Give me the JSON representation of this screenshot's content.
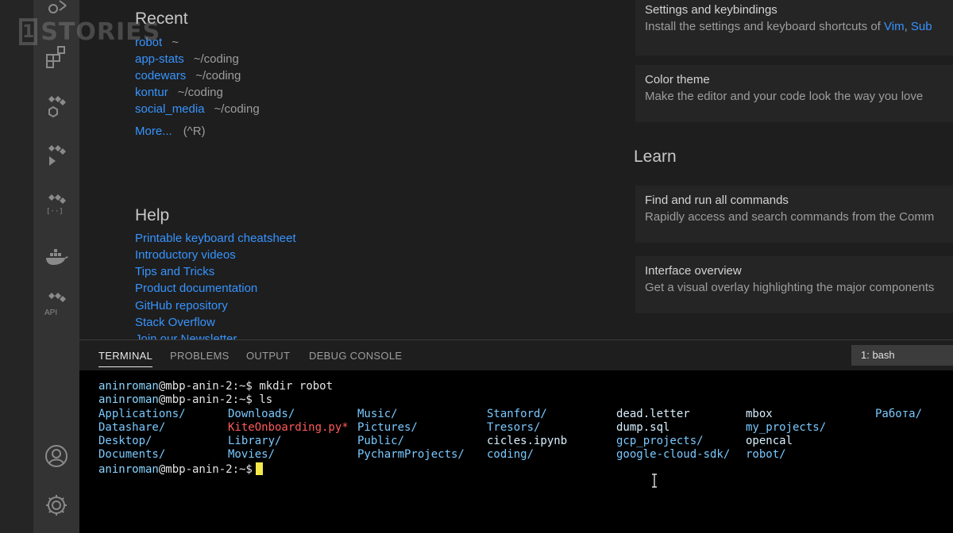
{
  "watermark": {
    "box": "1",
    "text": "STORIES"
  },
  "recent": {
    "title": "Recent",
    "items": [
      {
        "name": "robot",
        "path": "~"
      },
      {
        "name": "app-stats",
        "path": "~/coding"
      },
      {
        "name": "codewars",
        "path": "~/coding"
      },
      {
        "name": "kontur",
        "path": "~/coding"
      },
      {
        "name": "social_media",
        "path": "~/coding"
      }
    ],
    "more": "More...",
    "more_shortcut": "(^R)"
  },
  "help": {
    "title": "Help",
    "items": [
      "Printable keyboard cheatsheet",
      "Introductory videos",
      "Tips and Tricks",
      "Product documentation",
      "GitHub repository",
      "Stack Overflow",
      "Join our Newsletter"
    ]
  },
  "customize_cards": [
    {
      "title": "Settings and keybindings",
      "desc": "Install the settings and keyboard shortcuts of ",
      "links": [
        "Vim",
        "Sub"
      ]
    },
    {
      "title": "Color theme",
      "desc": "Make the editor and your code look the way you love"
    }
  ],
  "learn": {
    "title": "Learn",
    "cards": [
      {
        "title": "Find and run all commands",
        "desc": "Rapidly access and search commands from the Comm"
      },
      {
        "title": "Interface overview",
        "desc": "Get a visual overlay highlighting the major components"
      }
    ]
  },
  "activity": {
    "api_label": "API"
  },
  "panel": {
    "tabs": [
      "TERMINAL",
      "PROBLEMS",
      "OUTPUT",
      "DEBUG CONSOLE"
    ],
    "active_tab": "TERMINAL",
    "shell": "1: bash"
  },
  "terminal": {
    "prompt_user": "aninroman",
    "prompt_host": "@mbp-anin-2:~$",
    "commands": [
      "mkdir robot",
      "ls"
    ],
    "ls_rows": [
      [
        "Applications/",
        "Downloads/",
        "Music/",
        "Stanford/",
        "dead.letter",
        "mbox",
        "Работа/"
      ],
      [
        "Datashare/",
        "KiteOnboarding.py*",
        "Pictures/",
        "Tresors/",
        "dump.sql",
        "my_projects/",
        ""
      ],
      [
        "Desktop/",
        "Library/",
        "Public/",
        "cicles.ipynb",
        "gcp_projects/",
        "opencal",
        ""
      ],
      [
        "Documents/",
        "Movies/",
        "PycharmProjects/",
        "coding/",
        "google-cloud-sdk/",
        "robot/",
        ""
      ]
    ],
    "colors": {
      "user": "#8ad4ff",
      "dir": "#7ac9ff",
      "file": "#d8f0ff",
      "exec": "#ff5a5a",
      "cursor": "#f4e84a"
    }
  },
  "colors": {
    "link": "#3794ff",
    "editor_bg": "#1e1e1e",
    "activity_bg": "#333333",
    "terminal_bg": "#000000"
  }
}
